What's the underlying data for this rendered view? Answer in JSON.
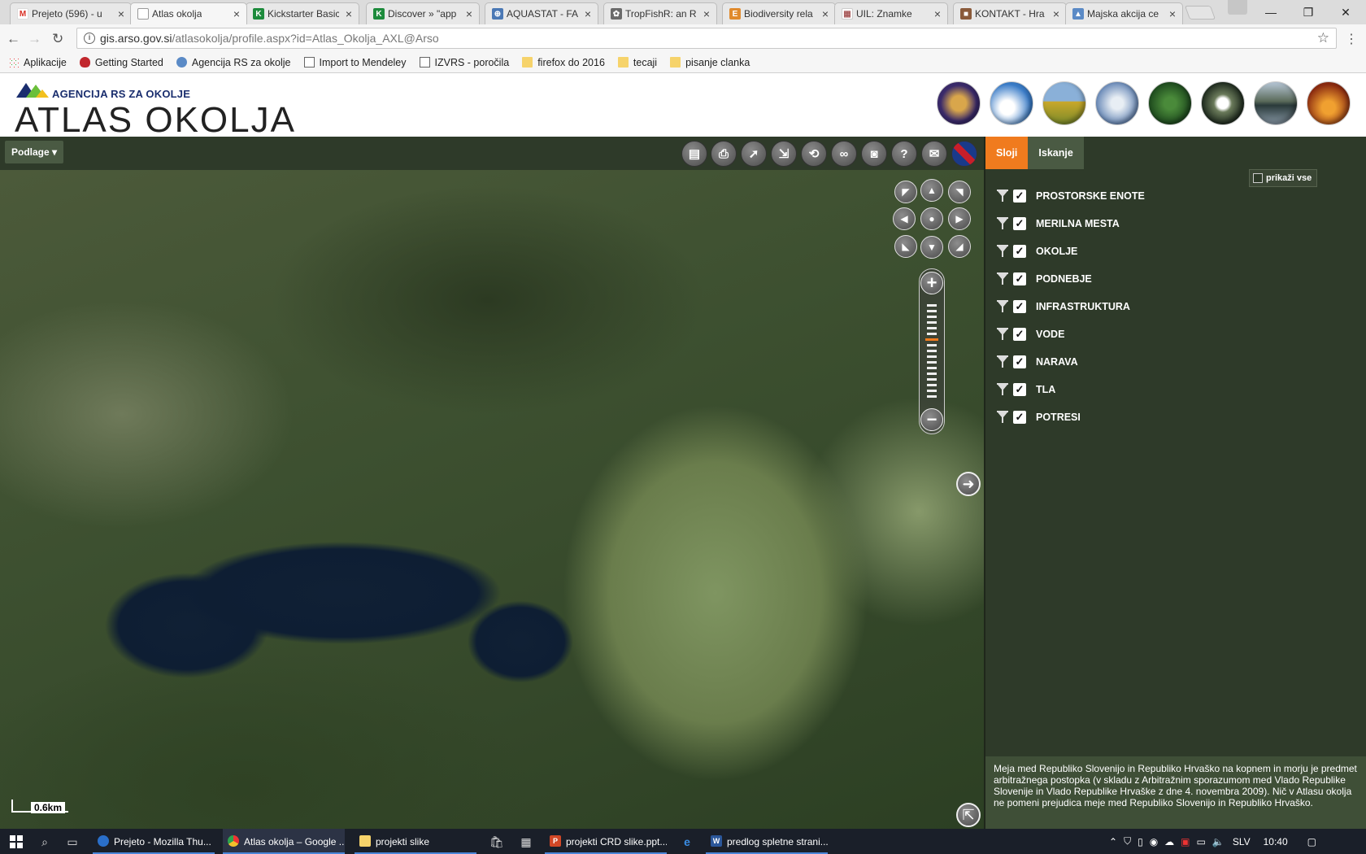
{
  "browser": {
    "tabs": [
      {
        "label": "Prejeto (596) - u",
        "icon_color": "#d93025",
        "icon_char": "M"
      },
      {
        "label": "Atlas okolja",
        "icon_color": "#888888",
        "icon_char": ""
      },
      {
        "label": "Kickstarter Basic",
        "icon_color": "#1d8b3c",
        "icon_char": "K"
      },
      {
        "label": "Discover » \"app",
        "icon_color": "#1d8b3c",
        "icon_char": "K"
      },
      {
        "label": "AQUASTAT - FA",
        "icon_color": "#4a78b5",
        "icon_char": "⊕"
      },
      {
        "label": "TropFishR: an R",
        "icon_color": "#6a6a6a",
        "icon_char": "✿"
      },
      {
        "label": "Biodiversity rela",
        "icon_color": "#e08a2c",
        "icon_char": "E"
      },
      {
        "label": "UIL: Znamke",
        "icon_color": "#a85a5a",
        "icon_char": "▦"
      },
      {
        "label": "KONTAKT - Hra",
        "icon_color": "#8a5a3a",
        "icon_char": "■"
      },
      {
        "label": "Majska akcija ce",
        "icon_color": "#5a8ac6",
        "icon_char": "▲"
      }
    ],
    "url_host": "gis.arso.gov.si",
    "url_path": "/atlasokolja/profile.aspx?id=Atlas_Okolja_AXL@Arso",
    "bookmarks": [
      {
        "label": "Aplikacije",
        "icon": "apps-icon"
      },
      {
        "label": "Getting Started",
        "icon": "firefox-icon"
      },
      {
        "label": "Agencija RS za okolje",
        "icon": "arso-icon"
      },
      {
        "label": "Import to Mendeley",
        "icon": "page-icon"
      },
      {
        "label": "IZVRS - poročila",
        "icon": "page-icon"
      },
      {
        "label": "firefox do 2016",
        "icon": "folder-icon"
      },
      {
        "label": "tecaji",
        "icon": "folder-icon"
      },
      {
        "label": "pisanje clanka",
        "icon": "folder-icon"
      }
    ]
  },
  "site": {
    "agency": "AGENCIJA RS ZA OKOLJE",
    "title": "ATLAS OKOLJA",
    "globes": [
      "slovenia-map-icon",
      "clouds-icon",
      "field-icon",
      "frost-tree-icon",
      "grass-icon",
      "dandelion-icon",
      "lake-icon",
      "fire-icon"
    ]
  },
  "toolbar": {
    "basemap_label": "Podlage ▾",
    "tools": [
      "legend-icon",
      "print-icon",
      "select-arrow-icon",
      "measure-icon",
      "back-extent-icon",
      "compare-icon",
      "camera-icon",
      "help-icon",
      "mail-icon",
      "english-flag-icon"
    ]
  },
  "map": {
    "scale_label": "0.6km"
  },
  "panel": {
    "tabs": [
      "Sloji",
      "Iskanje"
    ],
    "show_all_label": "prikaži vse",
    "layers": [
      {
        "label": "PROSTORSKE ENOTE",
        "checked": true
      },
      {
        "label": "MERILNA MESTA",
        "checked": true
      },
      {
        "label": "OKOLJE",
        "checked": true
      },
      {
        "label": "PODNEBJE",
        "checked": true
      },
      {
        "label": "INFRASTRUKTURA",
        "checked": true
      },
      {
        "label": "VODE",
        "checked": true
      },
      {
        "label": "NARAVA",
        "checked": true
      },
      {
        "label": "TLA",
        "checked": true
      },
      {
        "label": "POTRESI",
        "checked": true
      }
    ],
    "notice": "Meja med Republiko Slovenijo in Republiko Hrvaško na kopnem in morju je predmet arbitražnega postopka (v skladu z Arbitražnim sporazumom med Vlado Republike Slovenije in Vlado Republike Hrvaške z dne 4. novembra 2009). Nič v Atlasu okolja ne pomeni prejudica meje med Republiko Slovenijo in Republiko Hrvaško."
  },
  "taskbar": {
    "apps": [
      {
        "label": "Prejeto - Mozilla Thu...",
        "icon_color": "#2a6fc9"
      },
      {
        "label": "Atlas okolja – Google ...",
        "icon_color": "#e0b032"
      },
      {
        "label": "projekti slike",
        "icon_color": "#f6d36b"
      },
      {
        "label": "projekti CRD slike.ppt...",
        "icon_color": "#d24726"
      },
      {
        "label": "predlog spletne strani...",
        "icon_color": "#2b579a"
      }
    ],
    "lang": "SLV",
    "time": "10:40"
  }
}
